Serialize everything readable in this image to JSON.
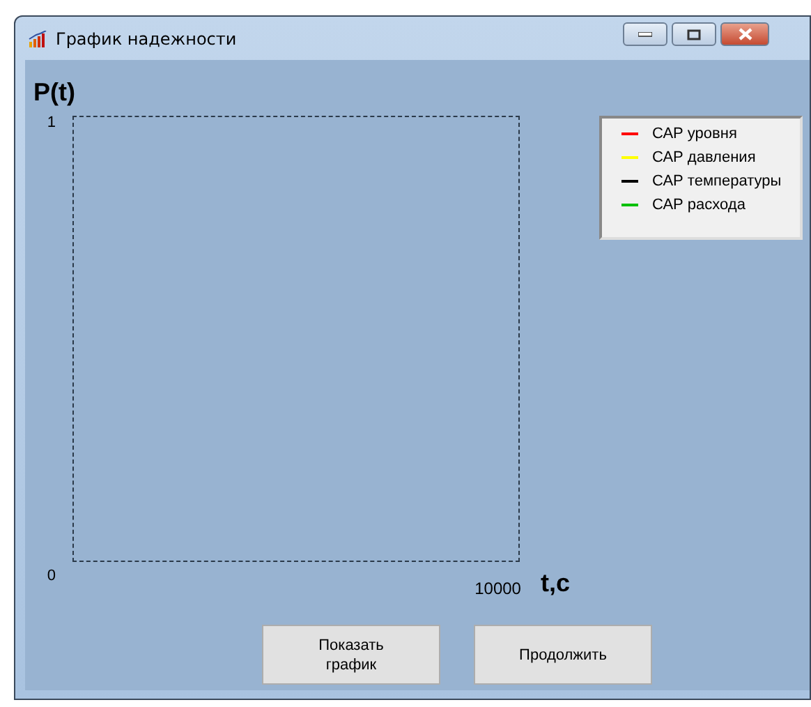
{
  "window": {
    "title": "График надежности"
  },
  "y_axis": {
    "label": "P(t)",
    "max": "1",
    "min": "0"
  },
  "x_axis": {
    "label": "t,c",
    "max": "10000"
  },
  "legend": [
    {
      "name": "САР уровня",
      "color": "#ff0000"
    },
    {
      "name": "САР давления",
      "color": "#ffff00"
    },
    {
      "name": "САР температуры",
      "color": "#000000"
    },
    {
      "name": "САР расхода",
      "color": "#00c000"
    }
  ],
  "buttons": [
    "Показать\nграфик",
    "Продолжить"
  ]
}
